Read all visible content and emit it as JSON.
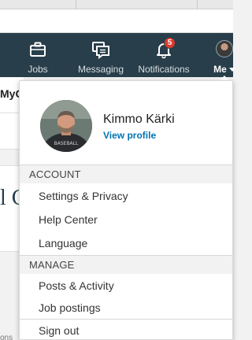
{
  "nav": {
    "items": [
      {
        "label": "Jobs",
        "icon": "briefcase-icon"
      },
      {
        "label": "Messaging",
        "icon": "messaging-icon"
      },
      {
        "label": "Notifications",
        "icon": "bell-icon",
        "badge": "5"
      },
      {
        "label": "Me",
        "icon": "avatar"
      }
    ]
  },
  "background": {
    "fragment_text": "MyC",
    "fragment_letter": "l C",
    "fragment_small": "ons"
  },
  "profile": {
    "name": "Kimmo Kärki",
    "link": "View profile"
  },
  "sections": {
    "account": {
      "title": "ACCOUNT",
      "items": [
        "Settings & Privacy",
        "Help Center",
        "Language"
      ]
    },
    "manage": {
      "title": "MANAGE",
      "items": [
        "Posts & Activity",
        "Job postings"
      ]
    },
    "signout": "Sign out"
  },
  "colors": {
    "nav_bg": "#283e4a",
    "link": "#0073b1",
    "badge": "#dd3b2e"
  }
}
